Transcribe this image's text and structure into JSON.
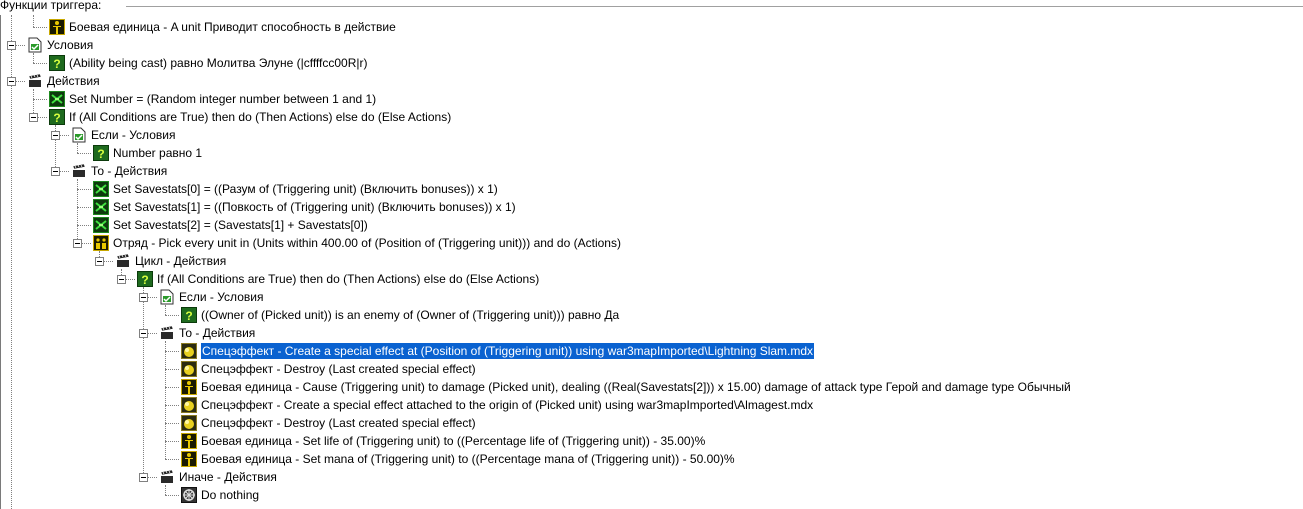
{
  "header": {
    "title": "Функции триггера:"
  },
  "rows": [
    {
      "text": "Боевая единица - A unit Приводит способность в действие",
      "icon": "unit-event-icon"
    },
    {
      "text": "Условия",
      "icon": "conditions-folder-icon"
    },
    {
      "text": "(Ability being cast) равно Молитва Элуне  (|cffffcc00R|r)",
      "icon": "condition-icon"
    },
    {
      "text": "Действия",
      "icon": "actions-folder-icon"
    },
    {
      "text": "Set Number = (Random integer number between 1 and 1)",
      "icon": "set-variable-icon"
    },
    {
      "text": "If (All Conditions are True) then do (Then Actions) else do (Else Actions)",
      "icon": "condition-icon"
    },
    {
      "text": "Если - Условия",
      "icon": "conditions-folder-icon"
    },
    {
      "text": "Number равно 1",
      "icon": "condition-icon"
    },
    {
      "text": "То - Действия",
      "icon": "actions-folder-icon"
    },
    {
      "text": "Set Savestats[0] = ((Разум of (Triggering unit) (Включить bonuses)) x 1)",
      "icon": "set-variable-icon"
    },
    {
      "text": "Set Savestats[1] = ((Повкость of (Triggering unit) (Включить bonuses)) x 1)",
      "icon": "set-variable-icon"
    },
    {
      "text": "Set Savestats[2] = (Savestats[1] + Savestats[0])",
      "icon": "set-variable-icon"
    },
    {
      "text": "Отряд - Pick every unit in (Units within 400.00 of (Position of (Triggering unit))) and do (Actions)",
      "icon": "unit-group-icon"
    },
    {
      "text": "Цикл - Действия",
      "icon": "actions-folder-icon"
    },
    {
      "text": "If (All Conditions are True) then do (Then Actions) else do (Else Actions)",
      "icon": "condition-icon"
    },
    {
      "text": "Если - Условия",
      "icon": "conditions-folder-icon"
    },
    {
      "text": "((Owner of (Picked unit)) is an enemy of (Owner of (Triggering unit))) равно Да",
      "icon": "condition-icon"
    },
    {
      "text": "То - Действия",
      "icon": "actions-folder-icon"
    },
    {
      "text": "Спецэффект - Create a special effect at (Position of (Triggering unit)) using war3mapImported\\Lightning Slam.mdx",
      "icon": "special-effect-icon",
      "selected": true
    },
    {
      "text": "Спецэффект - Destroy (Last created special effect)",
      "icon": "special-effect-icon"
    },
    {
      "text": "Боевая единица - Cause (Triggering unit) to damage (Picked unit), dealing ((Real(Savestats[2])) x 15.00) damage of attack type Герой and damage type Обычный",
      "icon": "unit-icon"
    },
    {
      "text": "Спецэффект - Create a special effect attached to the origin of (Picked unit) using war3mapImported\\Almagest.mdx",
      "icon": "special-effect-icon"
    },
    {
      "text": "Спецэффект - Destroy (Last created special effect)",
      "icon": "special-effect-icon"
    },
    {
      "text": "Боевая единица - Set life of (Triggering unit) to ((Percentage life of (Triggering unit)) - 35.00)%",
      "icon": "unit-icon"
    },
    {
      "text": "Боевая единица - Set mana of (Triggering unit) to ((Percentage mana of (Triggering unit)) - 50.00)%",
      "icon": "unit-icon"
    },
    {
      "text": "Иначе - Действия",
      "icon": "actions-folder-icon"
    },
    {
      "text": "Do nothing",
      "icon": "do-nothing-icon"
    }
  ]
}
